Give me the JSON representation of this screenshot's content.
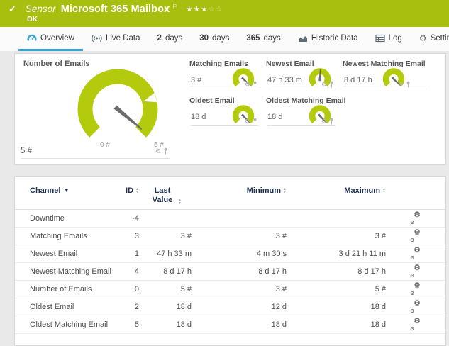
{
  "colors": {
    "status_green": "#a9bf0f",
    "gauge_green": "#b3cb0c",
    "accent_blue": "#36a6dc",
    "header_navy": "#203050"
  },
  "header": {
    "type_label": "Sensor",
    "title": "Microsoft 365 Mailbox",
    "status_text": "OK",
    "stars_filled": 3,
    "stars_total": 5
  },
  "tabs": [
    {
      "id": "overview",
      "icon": "gauge-icon",
      "label": "Overview",
      "active": true
    },
    {
      "id": "live-data",
      "icon": "live-data-icon",
      "label": "Live Data"
    },
    {
      "id": "2-days",
      "num": "2",
      "label": "days"
    },
    {
      "id": "30-days",
      "num": "30",
      "label": "days"
    },
    {
      "id": "365-days",
      "num": "365",
      "label": "days"
    },
    {
      "id": "historic-data",
      "icon": "historic-data-icon",
      "label": "Historic Data"
    },
    {
      "id": "log",
      "icon": "log-icon",
      "label": "Log"
    },
    {
      "id": "settings",
      "icon": "settings-icon",
      "label": "Settings"
    }
  ],
  "main_gauge": {
    "title": "Number of Emails",
    "value": "5 #",
    "scale_min": "0 #",
    "scale_max": "5 #",
    "needle_deg": 130
  },
  "mini_gauges": [
    {
      "title": "Matching Emails",
      "value": "3 #",
      "needle_deg": 133
    },
    {
      "title": "Newest Email",
      "value": "47 h 33 m",
      "needle_deg": 2
    },
    {
      "title": "Newest Matching Email",
      "value": "8 d 17 h",
      "needle_deg": 135
    },
    {
      "title": "Oldest Email",
      "value": "18 d",
      "needle_deg": 137
    },
    {
      "title": "Oldest Matching Email",
      "value": "18 d",
      "needle_deg": 137
    }
  ],
  "table": {
    "columns": [
      {
        "key": "channel",
        "label": "Channel",
        "sorted": true
      },
      {
        "key": "id",
        "label": "ID",
        "sortable": true
      },
      {
        "key": "last",
        "label": "Last Value",
        "sortable": true
      },
      {
        "key": "min",
        "label": "Minimum",
        "sortable": true
      },
      {
        "key": "max",
        "label": "Maximum",
        "sortable": true
      }
    ],
    "rows": [
      {
        "channel": "Downtime",
        "id": "-4",
        "last": "",
        "min": "",
        "max": ""
      },
      {
        "channel": "Matching Emails",
        "id": "3",
        "last": "3 #",
        "min": "3 #",
        "max": "3 #"
      },
      {
        "channel": "Newest Email",
        "id": "1",
        "last": "47 h 33 m",
        "min": "4 m 30 s",
        "max": "3 d 21 h 11 m"
      },
      {
        "channel": "Newest Matching Email",
        "id": "4",
        "last": "8 d 17 h",
        "min": "8 d 17 h",
        "max": "8 d 17 h"
      },
      {
        "channel": "Number of Emails",
        "id": "0",
        "last": "5 #",
        "min": "3 #",
        "max": "5 #"
      },
      {
        "channel": "Oldest Email",
        "id": "2",
        "last": "18 d",
        "min": "12 d",
        "max": "18 d"
      },
      {
        "channel": "Oldest Matching Email",
        "id": "5",
        "last": "18 d",
        "min": "18 d",
        "max": "18 d"
      }
    ]
  }
}
